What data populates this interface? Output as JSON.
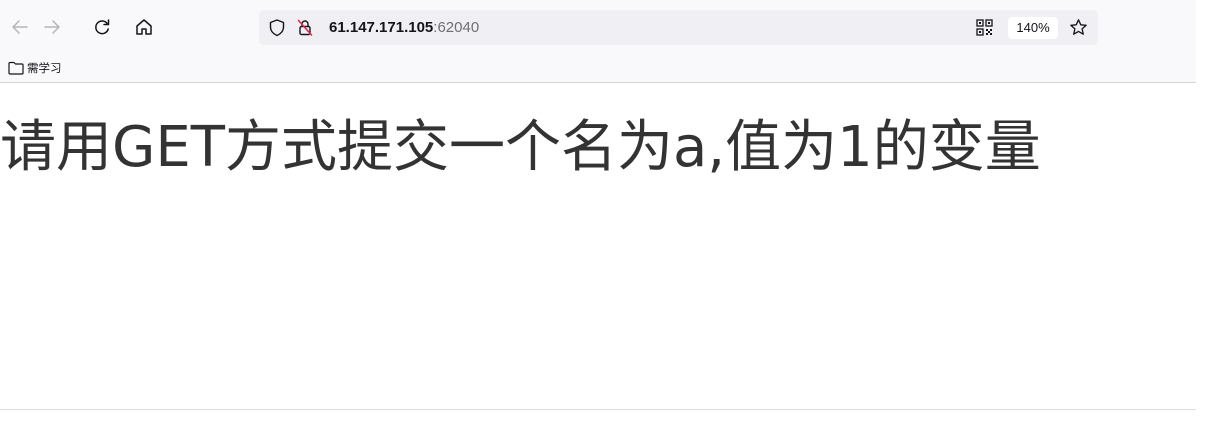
{
  "browser": {
    "url_host": "61.147.171.105",
    "url_port": ":62040",
    "zoom_level": "140%",
    "icons": {
      "back": "arrow-left-icon",
      "forward": "arrow-right-icon",
      "reload": "reload-icon",
      "home": "home-icon",
      "tracking_protection": "shield-icon",
      "insecure_connection": "lock-slash-icon",
      "qr_code": "qr-code-icon",
      "bookmark_star": "star-icon",
      "bookmark_folder": "folder-icon"
    },
    "colors": {
      "chrome_background": "#f9f9fb",
      "url_bar_background": "#f0f0f4",
      "insecure_icon_accent": "#e22850"
    }
  },
  "bookmarks": {
    "items": [
      {
        "label": "需学习"
      }
    ]
  },
  "page": {
    "heading": "请用GET方式提交一个名为a,值为1的变量",
    "text_color": "#333333"
  }
}
